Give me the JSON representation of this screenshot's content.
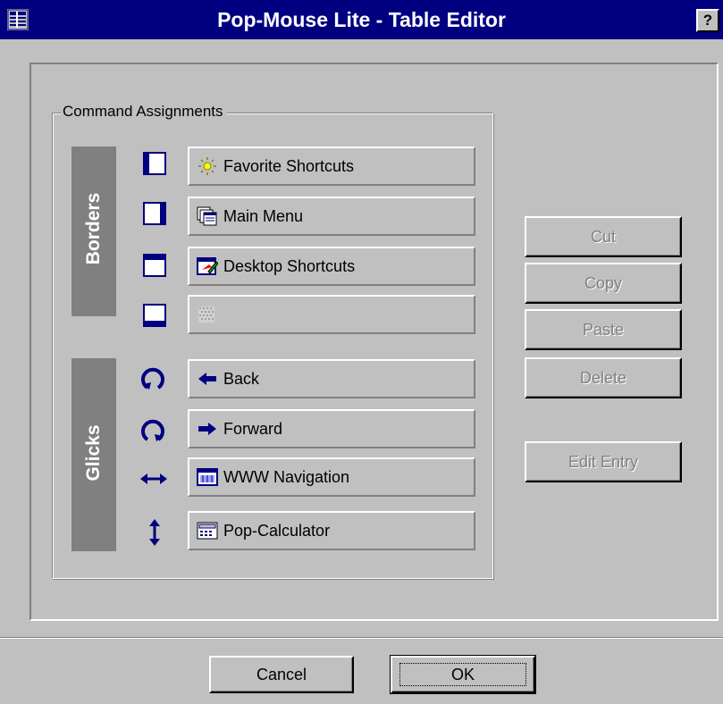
{
  "window": {
    "title": "Pop-Mouse Lite - Table Editor",
    "help_label": "?"
  },
  "group": {
    "label": "Command Assignments"
  },
  "sections": {
    "borders_label": "Borders",
    "glicks_label": "Glicks"
  },
  "entries": [
    {
      "label": "Favorite Shortcuts",
      "icon": "favorites-sun-icon"
    },
    {
      "label": "Main Menu",
      "icon": "main-menu-icon"
    },
    {
      "label": "Desktop Shortcuts",
      "icon": "desktop-shortcuts-icon"
    },
    {
      "label": "",
      "icon": "empty-placeholder-icon"
    },
    {
      "label": "Back",
      "icon": "arrow-left-icon"
    },
    {
      "label": "Forward",
      "icon": "arrow-right-icon"
    },
    {
      "label": "WWW Navigation",
      "icon": "www-navigation-icon"
    },
    {
      "label": "Pop-Calculator",
      "icon": "calculator-icon"
    }
  ],
  "side_buttons": {
    "cut": "Cut",
    "copy": "Copy",
    "paste": "Paste",
    "delete": "Delete",
    "edit_entry": "Edit Entry"
  },
  "footer": {
    "cancel": "Cancel",
    "ok": "OK"
  },
  "colors": {
    "face": "#c0c0c0",
    "title_bar": "#000080",
    "sidebar": "#808080",
    "disabled_text": "#808080"
  }
}
